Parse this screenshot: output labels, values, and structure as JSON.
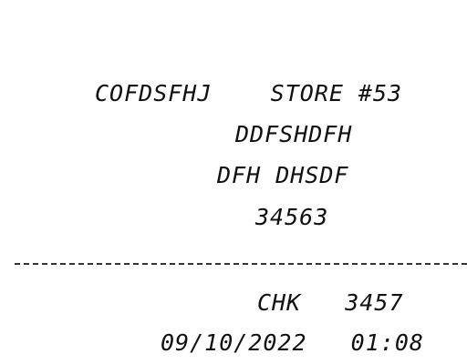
{
  "receipt": {
    "header_line": "COFDSFHJ    STORE #53",
    "address_1": "DDFSHDFH",
    "address_2": "DFH DHSDF",
    "zip": "34563",
    "check_line": "CHK   3457",
    "datetime_line": "09/10/2022   01:08"
  }
}
